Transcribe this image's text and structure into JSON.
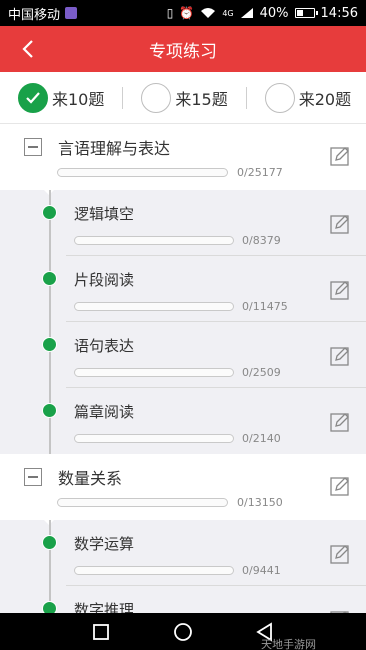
{
  "status_bar": {
    "carrier": "中国移动",
    "network": "4G",
    "battery": "40%",
    "battery_level": 0.4,
    "time": "14:56"
  },
  "header": {
    "title": "专项练习",
    "back_icon": "chevron-left-icon"
  },
  "count_options": [
    {
      "label": "来10题",
      "selected": true
    },
    {
      "label": "来15题",
      "selected": false
    },
    {
      "label": "来20题",
      "selected": false
    }
  ],
  "categories": [
    {
      "name": "言语理解与表达",
      "count": "0/25177",
      "progress": 0,
      "children": [
        {
          "name": "逻辑填空",
          "count": "0/8379",
          "progress": 0
        },
        {
          "name": "片段阅读",
          "count": "0/11475",
          "progress": 0
        },
        {
          "name": "语句表达",
          "count": "0/2509",
          "progress": 0
        },
        {
          "name": "篇章阅读",
          "count": "0/2140",
          "progress": 0
        }
      ]
    },
    {
      "name": "数量关系",
      "count": "0/13150",
      "progress": 0,
      "children": [
        {
          "name": "数学运算",
          "count": "0/9441",
          "progress": 0
        },
        {
          "name": "数字推理",
          "count": "",
          "progress": 0
        }
      ]
    }
  ],
  "watermark": "天地手游网",
  "colors": {
    "brand_red": "#e73c3c",
    "accent_green": "#19a149"
  }
}
